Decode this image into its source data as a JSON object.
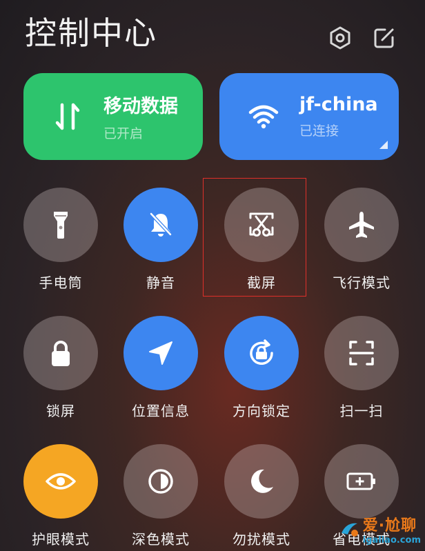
{
  "header": {
    "title": "控制中心"
  },
  "top_icons": [
    {
      "icon": "settings-hexagon-icon"
    },
    {
      "icon": "edit-icon"
    }
  ],
  "tiles": [
    {
      "name": "移动数据",
      "status": "已开启",
      "icon": "mobile-data-arrows-icon",
      "color": "#2dc46d"
    },
    {
      "name": "jf-china",
      "status": "已连接",
      "icon": "wifi-icon",
      "color": "#3d86f0"
    }
  ],
  "buttons": [
    {
      "label": "手电筒",
      "icon": "flashlight-icon",
      "active": false
    },
    {
      "label": "静音",
      "icon": "bell-muted-icon",
      "active": true
    },
    {
      "label": "截屏",
      "icon": "screenshot-scissors-icon",
      "active": false,
      "highlighted": true
    },
    {
      "label": "飞行模式",
      "icon": "airplane-icon",
      "active": false
    },
    {
      "label": "锁屏",
      "icon": "lock-icon",
      "active": false
    },
    {
      "label": "位置信息",
      "icon": "location-arrow-icon",
      "active": true
    },
    {
      "label": "方向锁定",
      "icon": "rotation-lock-icon",
      "active": true
    },
    {
      "label": "扫一扫",
      "icon": "scan-icon",
      "active": false
    },
    {
      "label": "护眼模式",
      "icon": "eye-icon",
      "active": true,
      "color": "#f5a623"
    },
    {
      "label": "深色模式",
      "icon": "dark-mode-icon",
      "active": false
    },
    {
      "label": "勿扰模式",
      "icon": "moon-icon",
      "active": false
    },
    {
      "label": "省电模式",
      "icon": "battery-saver-icon",
      "active": false
    }
  ],
  "watermark": {
    "main": "爱·尬聊",
    "sub": "igaliao.com"
  },
  "colors": {
    "active_blue": "#3d86f0",
    "green": "#2dc46d",
    "orange": "#f5a623",
    "highlight_red": "#e0302a"
  }
}
